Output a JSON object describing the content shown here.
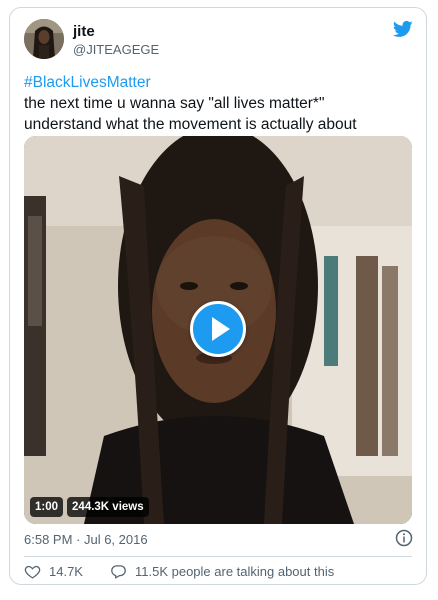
{
  "tweet": {
    "author": {
      "display_name": "jite",
      "handle": "@JITEAGEGE"
    },
    "hashtag": "#BlackLivesMatter",
    "text_lines": [
      "the next time u wanna say \"all lives matter*\"",
      "understand what the movement is actually about"
    ],
    "video": {
      "duration": "1:00",
      "views": "244.3K views"
    },
    "timestamp": "6:58 PM · Jul 6, 2016",
    "likes": "14.7K",
    "replies_text": "11.5K people are talking about this"
  },
  "icons": {
    "brand": "twitter-bird-icon",
    "info": "info-icon",
    "like": "heart-icon",
    "reply": "speech-bubble-icon",
    "play": "play-icon"
  },
  "colors": {
    "accent": "#1d9bf0",
    "text": "#0f1419",
    "secondary": "#536471",
    "border": "#cfd9de"
  }
}
